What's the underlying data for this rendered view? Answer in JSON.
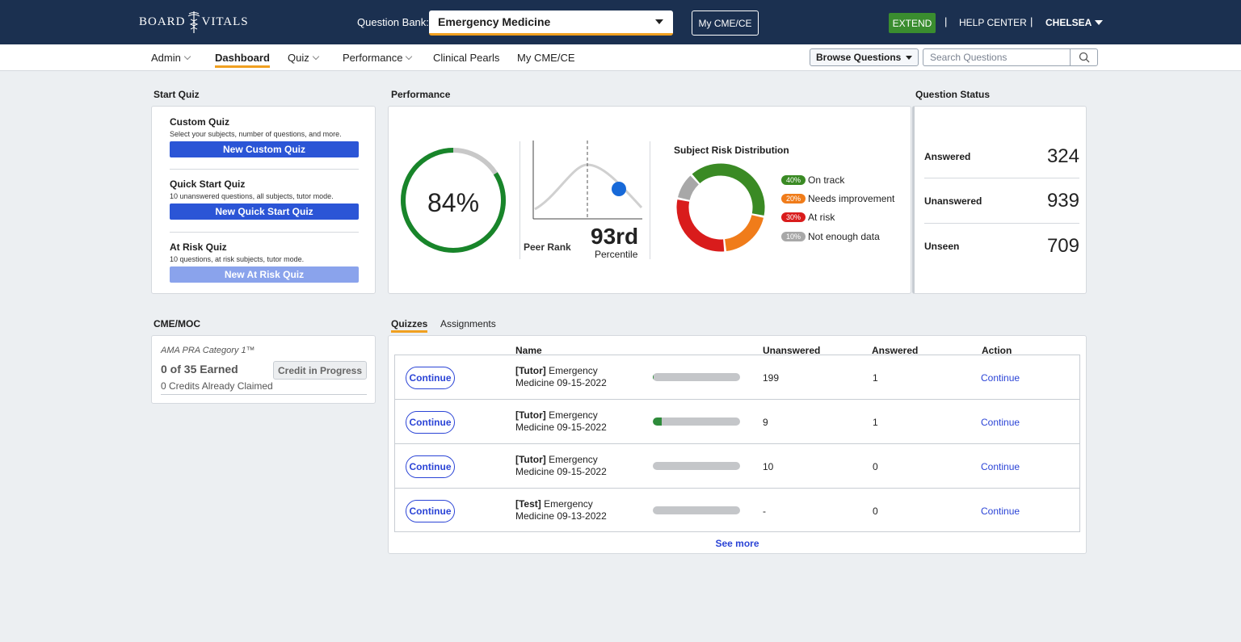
{
  "header": {
    "logo_left": "BOARD",
    "logo_right": "VITALS",
    "question_bank_label": "Question Bank:",
    "question_bank_value": "Emergency Medicine",
    "my_cme_button": "My CME/CE",
    "extend_button": "EXTEND",
    "separator": "|",
    "help_center": "HELP CENTER",
    "user_name": "CHELSEA"
  },
  "nav": {
    "items": [
      {
        "label": "Admin"
      },
      {
        "label": "Dashboard"
      },
      {
        "label": "Quiz"
      },
      {
        "label": "Performance"
      },
      {
        "label": "Clinical Pearls"
      },
      {
        "label": "My CME/CE"
      }
    ],
    "browse_button": "Browse Questions",
    "search_placeholder": "Search Questions"
  },
  "start_quiz": {
    "title": "Start Quiz",
    "blocks": [
      {
        "title": "Custom Quiz",
        "desc": "Select your subjects, number of questions, and more.",
        "button": "New Custom Quiz"
      },
      {
        "title": "Quick Start Quiz",
        "desc": "10 unanswered questions, all subjects, tutor mode.",
        "button": "New Quick Start Quiz"
      },
      {
        "title": "At Risk Quiz",
        "desc": "10 questions, at risk subjects, tutor mode.",
        "button": "New At Risk Quiz"
      }
    ]
  },
  "performance": {
    "title": "Performance",
    "score_pct": "84%",
    "score_value": 84,
    "peer_rank_label": "Peer Rank",
    "percentile_value": "93rd",
    "percentile_label": "Percentile",
    "risk_title": "Subject Risk Distribution",
    "risk": [
      {
        "pct": "40%",
        "label": "On track",
        "value": 40,
        "color": "#3a8a24"
      },
      {
        "pct": "20%",
        "label": "Needs improvement",
        "value": 20,
        "color": "#f07c1a"
      },
      {
        "pct": "30%",
        "label": "At risk",
        "value": 30,
        "color": "#d91c1c"
      },
      {
        "pct": "10%",
        "label": "Not enough data",
        "value": 10,
        "color": "#a8a8a8"
      }
    ]
  },
  "question_status": {
    "title": "Question Status",
    "rows": [
      {
        "label": "Answered",
        "value": "324"
      },
      {
        "label": "Unanswered",
        "value": "939"
      },
      {
        "label": "Unseen",
        "value": "709"
      }
    ]
  },
  "cme": {
    "title": "CME/MOC",
    "category": "AMA PRA Category 1™",
    "earned": "0 of 35 Earned",
    "credit_button": "Credit in Progress",
    "claimed": "0 Credits Already Claimed"
  },
  "quizzes": {
    "tabs": [
      "Quizzes",
      "Assignments"
    ],
    "headers": {
      "name": "Name",
      "unanswered": "Unanswered",
      "answered": "Answered",
      "action": "Action"
    },
    "rows": [
      {
        "button": "Continue",
        "tag": "[Tutor]",
        "name_line1": " Emergency",
        "name_line2": "Medicine 09-15-2022",
        "progress": 0.005,
        "unanswered": "199",
        "answered": "1",
        "action": "Continue"
      },
      {
        "button": "Continue",
        "tag": "[Tutor]",
        "name_line1": " Emergency",
        "name_line2": "Medicine 09-15-2022",
        "progress": 0.1,
        "unanswered": "9",
        "answered": "1",
        "action": "Continue"
      },
      {
        "button": "Continue",
        "tag": "[Tutor]",
        "name_line1": " Emergency",
        "name_line2": "Medicine 09-15-2022",
        "progress": 0,
        "unanswered": "10",
        "answered": "0",
        "action": "Continue"
      },
      {
        "button": "Continue",
        "tag": "[Test]",
        "name_line1": " Emergency",
        "name_line2": "Medicine 09-13-2022",
        "progress": 0,
        "unanswered": "-",
        "answered": "0",
        "action": "Continue"
      }
    ],
    "see_more": "See more"
  }
}
